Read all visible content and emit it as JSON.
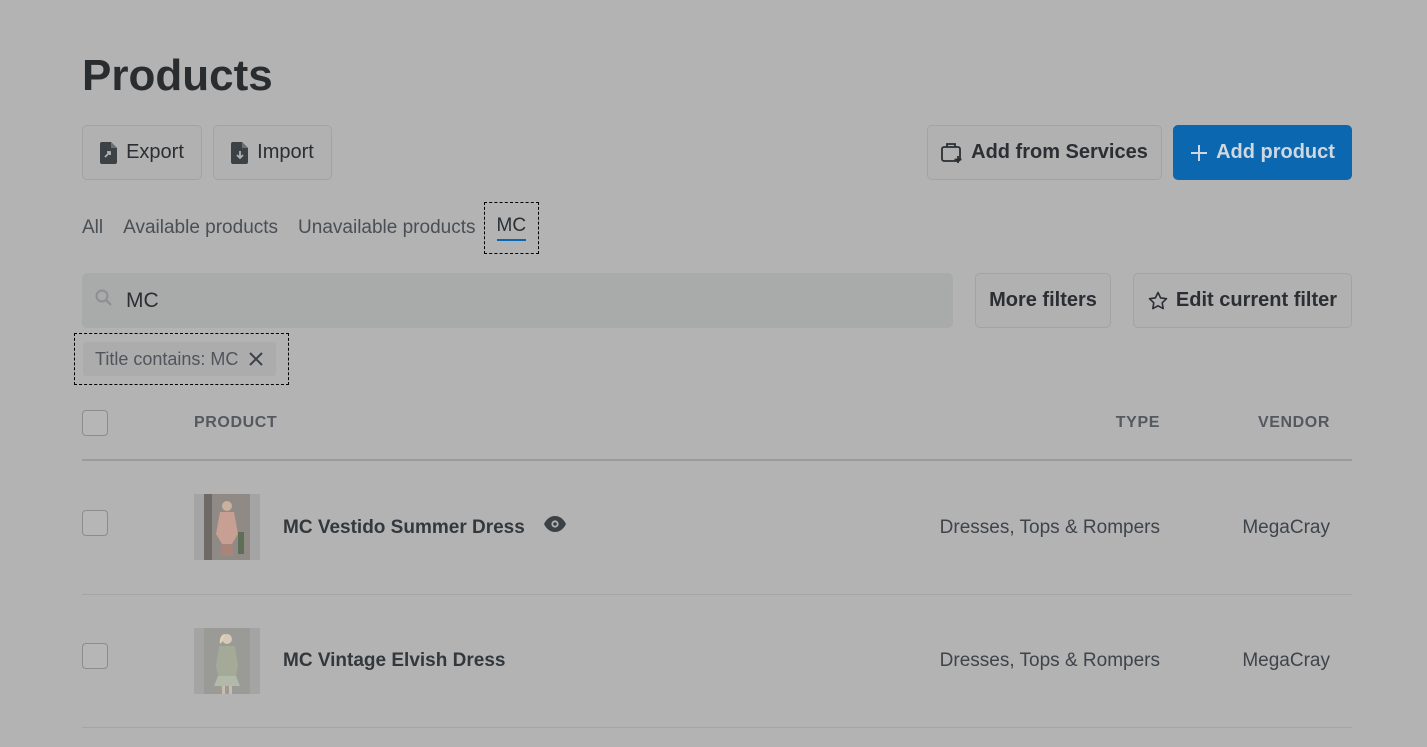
{
  "page": {
    "title": "Products"
  },
  "toolbar": {
    "export_label": "Export",
    "import_label": "Import",
    "add_services_label": "Add from Services",
    "add_product_label": "Add product"
  },
  "tabs": [
    {
      "label": "All"
    },
    {
      "label": "Available products"
    },
    {
      "label": "Unavailable products"
    },
    {
      "label": "MC"
    }
  ],
  "search": {
    "value": "MC"
  },
  "filters": {
    "more_label": "More filters",
    "edit_label": "Edit current filter",
    "chip_label": "Title contains: MC"
  },
  "table": {
    "headers": {
      "product": "PRODUCT",
      "type": "TYPE",
      "vendor": "VENDOR"
    },
    "rows": [
      {
        "name": "MC Vestido Summer Dress",
        "type": "Dresses, Tops & Rompers",
        "vendor": "MegaCray"
      },
      {
        "name": "MC Vintage Elvish Dress",
        "type": "Dresses, Tops & Rompers",
        "vendor": "MegaCray"
      }
    ]
  },
  "colors": {
    "accent": "#0b67b0",
    "overlay": "#b3b3b3"
  },
  "icons": {
    "export": "file-export-icon",
    "import": "file-import-icon",
    "services": "briefcase-plus-icon",
    "add": "plus-icon",
    "search": "search-icon",
    "star": "star-icon",
    "close": "close-icon",
    "visible": "eye-icon"
  }
}
